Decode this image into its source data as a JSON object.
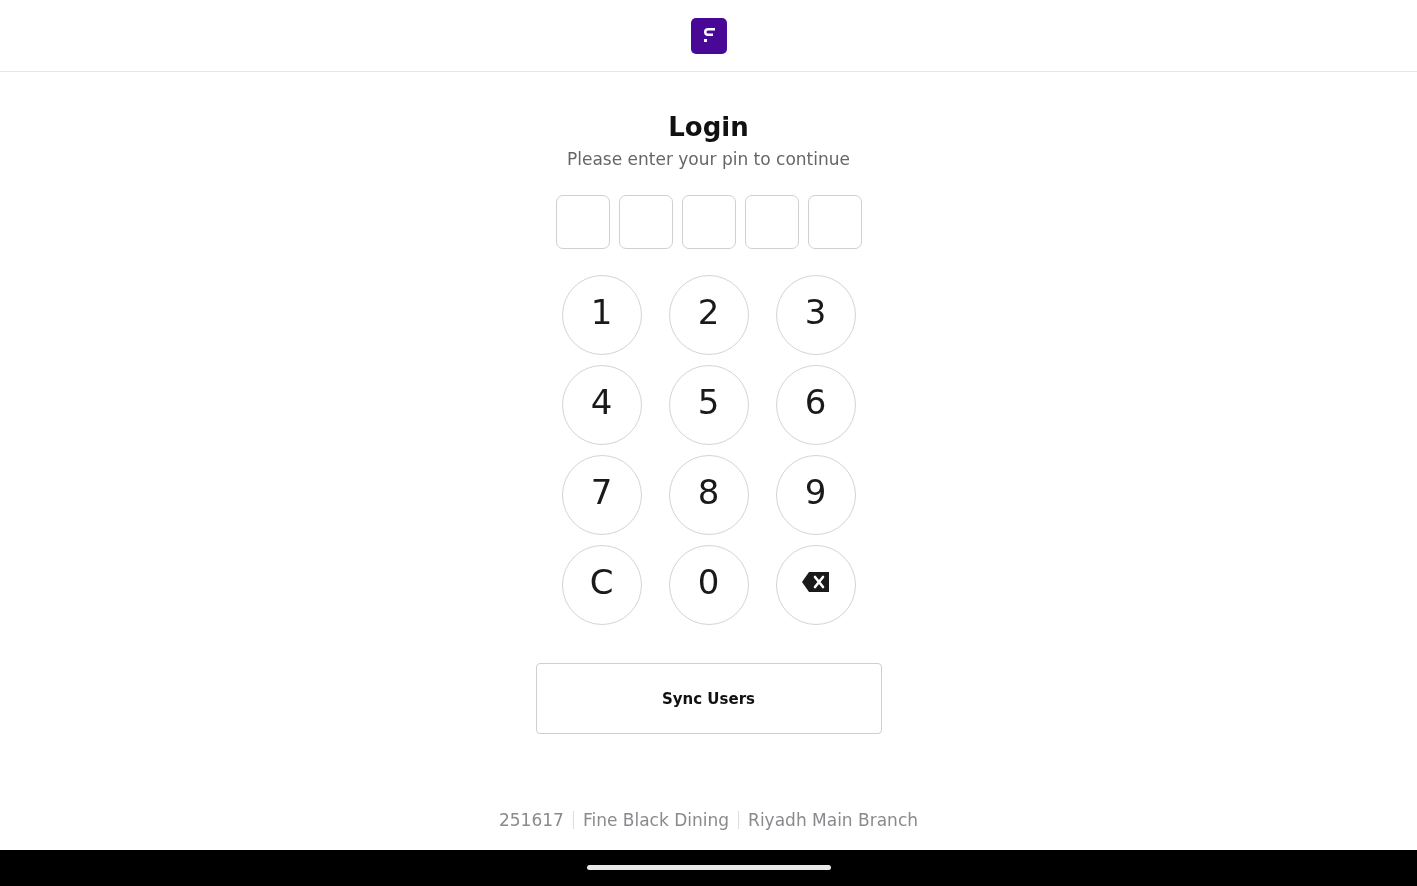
{
  "title": "Login",
  "subtitle": "Please enter your pin to continue",
  "pin_boxes": [
    {
      "filled": false
    },
    {
      "filled": false
    },
    {
      "filled": false
    },
    {
      "filled": false
    },
    {
      "filled": false
    }
  ],
  "keys": [
    {
      "kind": "digit",
      "label": "1"
    },
    {
      "kind": "digit",
      "label": "2"
    },
    {
      "kind": "digit",
      "label": "3"
    },
    {
      "kind": "digit",
      "label": "4"
    },
    {
      "kind": "digit",
      "label": "5"
    },
    {
      "kind": "digit",
      "label": "6"
    },
    {
      "kind": "digit",
      "label": "7"
    },
    {
      "kind": "digit",
      "label": "8"
    },
    {
      "kind": "digit",
      "label": "9"
    },
    {
      "kind": "digit",
      "label": "C"
    },
    {
      "kind": "digit",
      "label": "0"
    },
    {
      "kind": "backspace"
    }
  ],
  "sync_button": "Sync Users",
  "footer": [
    "251617",
    "Fine Black Dining",
    "Riyadh Main Branch"
  ]
}
